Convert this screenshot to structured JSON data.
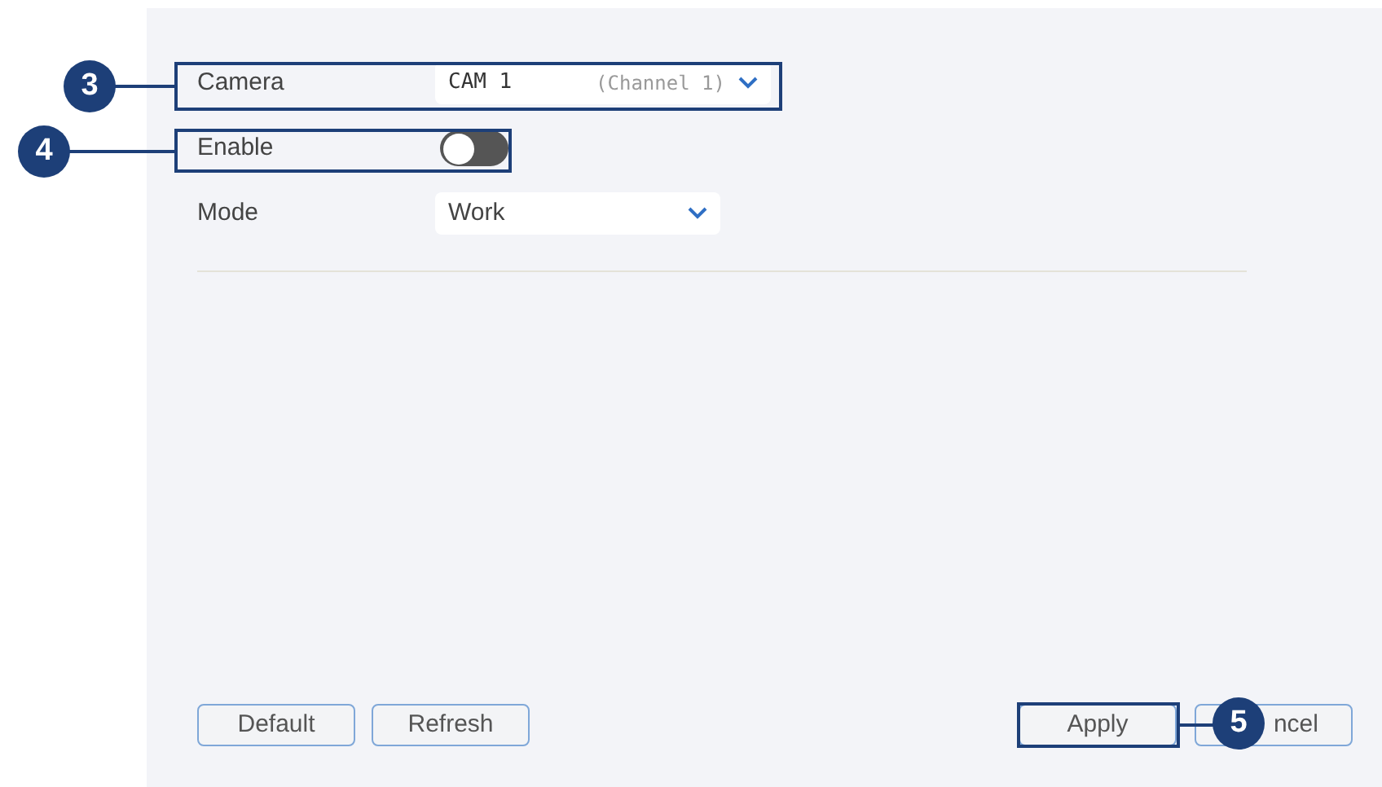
{
  "fields": [
    {
      "kind": "select",
      "label": "Camera",
      "value": "CAM 1",
      "hint": "(Channel 1)",
      "mono": true
    },
    {
      "kind": "toggle",
      "label": "Enable",
      "on": false
    },
    {
      "kind": "select",
      "label": "Mode",
      "value": "Work"
    }
  ],
  "buttons_left": [
    "Default",
    "Refresh"
  ],
  "buttons_right": [
    {
      "label": "Apply"
    },
    {
      "label": "ncel"
    }
  ],
  "callouts": [
    "3",
    "4",
    "5"
  ]
}
